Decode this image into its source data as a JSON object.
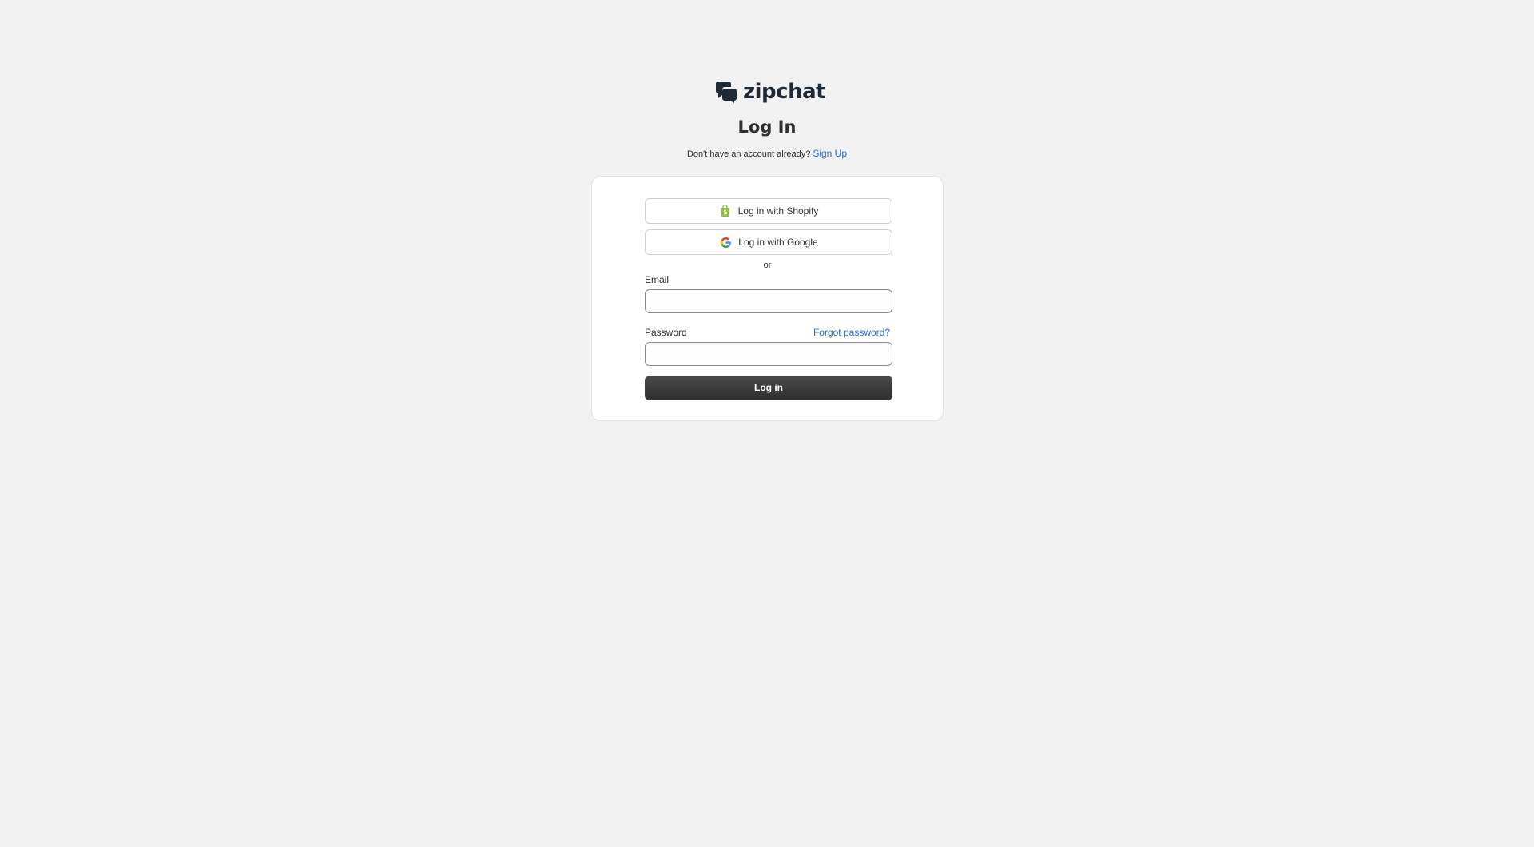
{
  "brand": {
    "name": "zipchat",
    "logo_icon": "zipchat-chat-bubble-icon",
    "color": "#1f2a37"
  },
  "page": {
    "title": "Log In",
    "signup_prompt": "Don't have an account already?",
    "signup_link": "Sign Up"
  },
  "oauth": {
    "shopify_label": "Log in with Shopify",
    "shopify_icon": "shopify-bag-icon",
    "google_label": "Log in with Google",
    "google_icon": "google-g-icon"
  },
  "form": {
    "divider": "or",
    "email_label": "Email",
    "email_value": "",
    "email_placeholder": "",
    "password_label": "Password",
    "password_value": "",
    "password_placeholder": "",
    "forgot_password": "Forgot password?",
    "submit_label": "Log in"
  },
  "colors": {
    "background": "#f1f1f1",
    "link": "#2c6ecb",
    "primary_button": "#3a3a3a",
    "shopify_green": "#95bf47"
  }
}
